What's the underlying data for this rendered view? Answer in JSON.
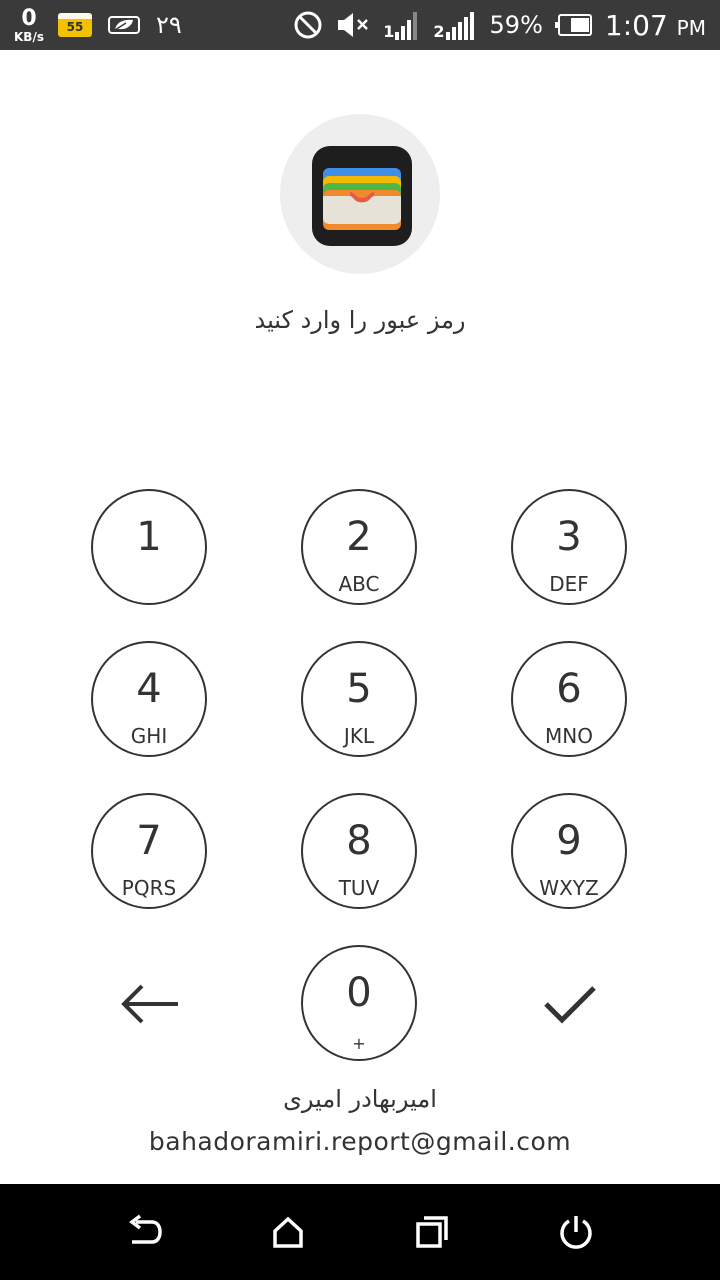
{
  "status_bar": {
    "net_speed_value": "0",
    "net_speed_unit": "KB/s",
    "sd_badge": "55",
    "day": "۲۹",
    "signal1_label": "1",
    "signal2_label": "2",
    "battery": "59%",
    "time": "1:07",
    "ampm": "PM",
    "icons": [
      "dnd-icon",
      "mute-icon",
      "signal-icon",
      "battery-icon",
      "leaf-icon"
    ]
  },
  "app": {
    "icon": "wallet-icon",
    "prompt": "رمز عبور را وارد کنید"
  },
  "keypad": {
    "keys": [
      {
        "digit": "1",
        "letters": ""
      },
      {
        "digit": "2",
        "letters": "ABC"
      },
      {
        "digit": "3",
        "letters": "DEF"
      },
      {
        "digit": "4",
        "letters": "GHI"
      },
      {
        "digit": "5",
        "letters": "JKL"
      },
      {
        "digit": "6",
        "letters": "MNO"
      },
      {
        "digit": "7",
        "letters": "PQRS"
      },
      {
        "digit": "8",
        "letters": "TUV"
      },
      {
        "digit": "9",
        "letters": "WXYZ"
      },
      {
        "digit": "0",
        "letters": "+"
      }
    ],
    "backspace_icon": "back-arrow-icon",
    "confirm_icon": "checkmark-icon"
  },
  "owner": {
    "name": "امیربهادر امیری",
    "email": "bahadoramiri.report@gmail.com"
  },
  "nav_bar": {
    "icons": [
      "nav-back-icon",
      "nav-home-icon",
      "nav-recents-icon",
      "nav-power-icon"
    ]
  },
  "colors": {
    "status_bar": "#3a3a3a",
    "text": "#333333",
    "avatar_bg": "#eeeeee",
    "nav_bar": "#000000"
  }
}
